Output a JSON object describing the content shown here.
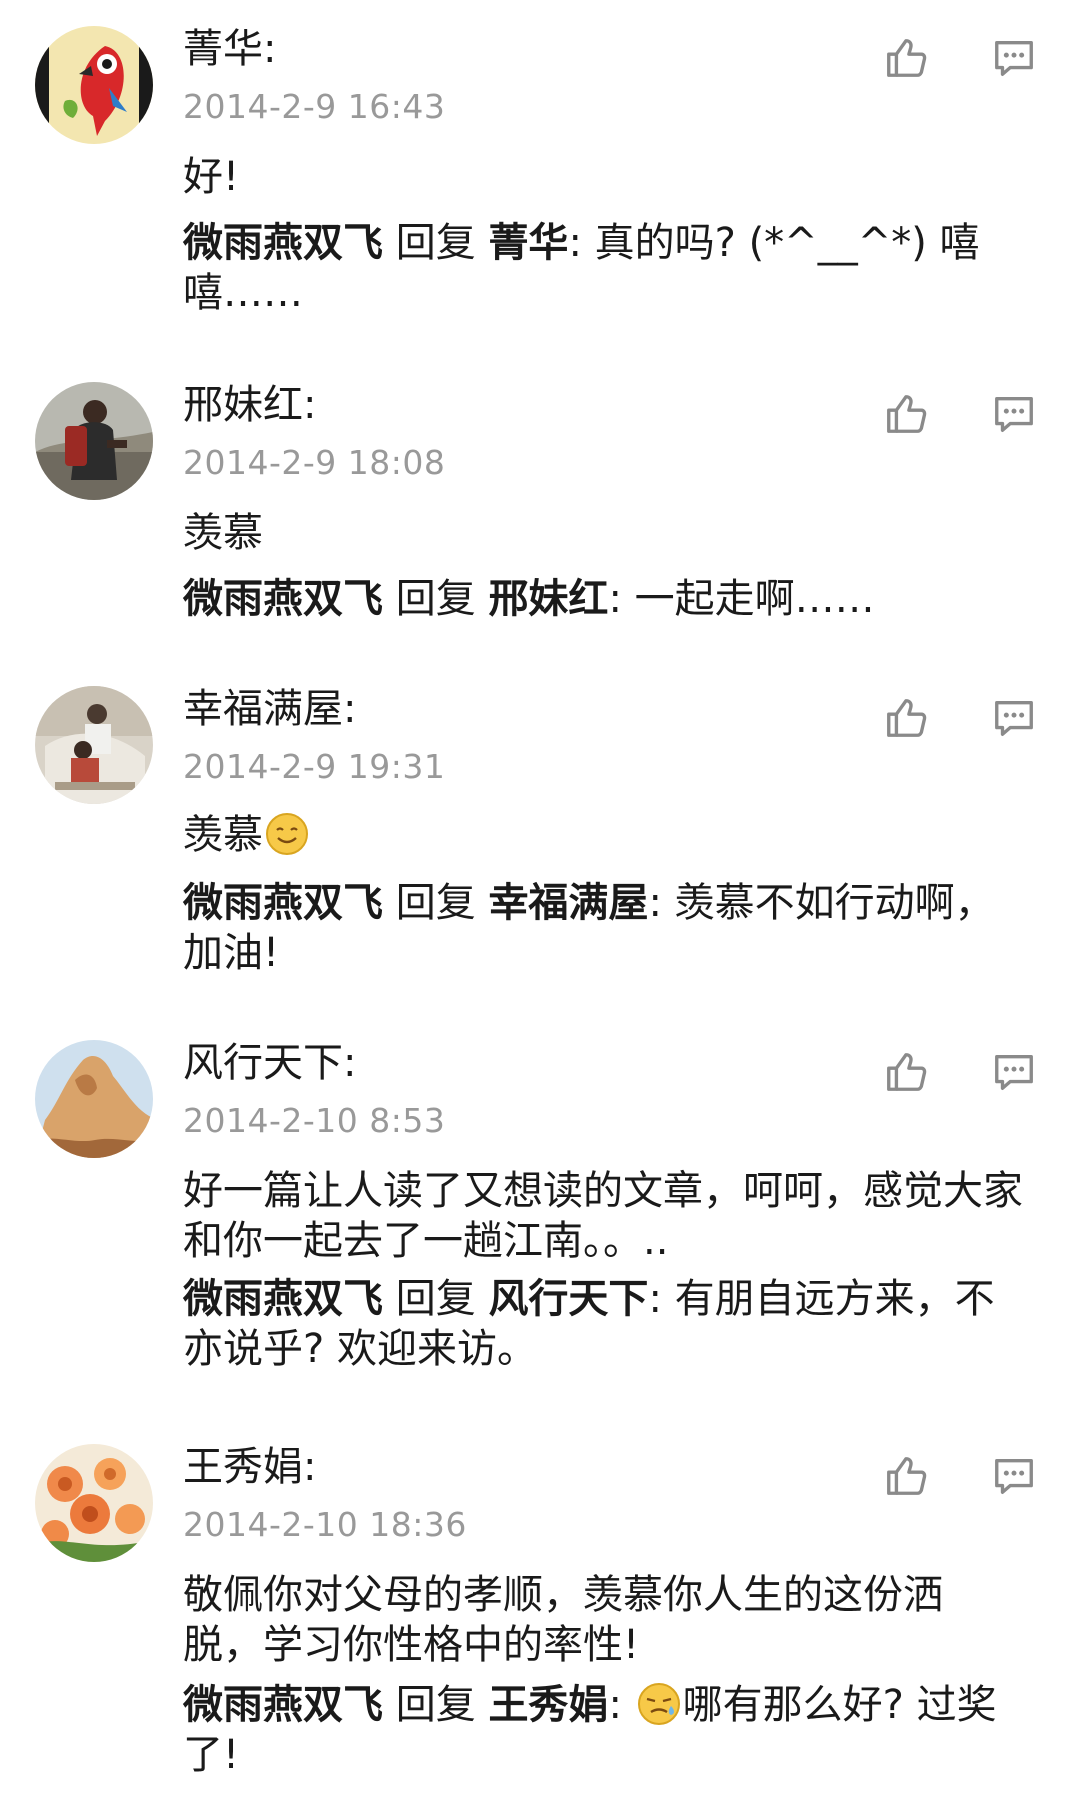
{
  "comments": [
    {
      "name": "菁华:",
      "time": "2014-2-9 16:43",
      "text": "好!",
      "reply": {
        "author": "微雨燕双飞",
        "verb": " 回复 ",
        "target": "菁华",
        "text": ": 真的吗? (*^__^*) 嘻嘻……"
      },
      "avatar": "parrot-avatar"
    },
    {
      "name": "邢妹红:",
      "time": "2014-2-9 18:08",
      "text": "羡慕",
      "reply": {
        "author": "微雨燕双飞",
        "verb": " 回复 ",
        "target": "邢妹红",
        "text": ": 一起走啊……"
      },
      "avatar": "hiker-avatar"
    },
    {
      "name": "幸福满屋:",
      "time": "2014-2-9 19:31",
      "text": "羡慕",
      "text_emoji": "smile-emoji",
      "reply": {
        "author": "微雨燕双飞",
        "verb": " 回复 ",
        "target": "幸福满屋",
        "text": ": 羡慕不如行动啊，加油!"
      },
      "avatar": "family-avatar"
    },
    {
      "name": "风行天下:",
      "time": "2014-2-10 8:53",
      "text": "好一篇让人读了又想读的文章，呵呵，感觉大家和你一起去了一趟江南。。..",
      "reply": {
        "author": "微雨燕双飞",
        "verb": " 回复 ",
        "target": "风行天下",
        "text": ": 有朋自远方来，不亦说乎? 欢迎来访。"
      },
      "avatar": "mountain-avatar"
    },
    {
      "name": "王秀娟:",
      "time": "2014-2-10 18:36",
      "text": "敬佩你对父母的孝顺，羡慕你人生的这份洒脱，学习你性格中的率性!",
      "reply": {
        "author": "微雨燕双飞",
        "verb": " 回复 ",
        "target": "王秀娟",
        "emoji": "embarrassed-emoji",
        "text": "哪有那么好? 过奖了!"
      },
      "avatar": "flowers-avatar"
    }
  ],
  "icons": {
    "like": "thumbs-up-icon",
    "reply": "comment-icon"
  },
  "colors": {
    "text": "#1a1a1a",
    "timestamp": "#999999",
    "icon": "#8a8a8a"
  }
}
